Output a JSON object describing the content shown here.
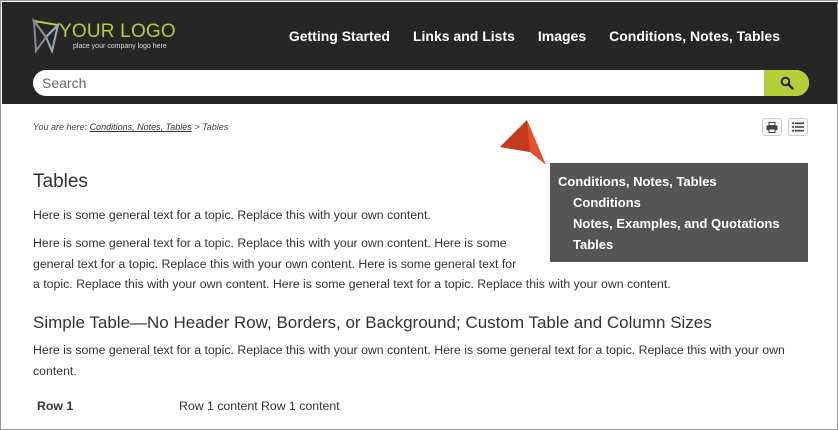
{
  "logo": {
    "title": "YOUR LOGO",
    "subtitle": "place your company logo here"
  },
  "nav": {
    "items": [
      {
        "label": "Getting Started"
      },
      {
        "label": "Links and Lists"
      },
      {
        "label": "Images"
      },
      {
        "label": "Conditions, Notes, Tables"
      }
    ]
  },
  "search": {
    "placeholder": "Search"
  },
  "breadcrumb": {
    "prefix": "You are here:",
    "link": "Conditions, Notes, Tables",
    "separator": ">",
    "current": "Tables"
  },
  "mini_toc": {
    "parent": "Conditions, Notes, Tables",
    "items": [
      {
        "label": "Conditions"
      },
      {
        "label": "Notes, Examples, and Quotations"
      },
      {
        "label": "Tables"
      }
    ]
  },
  "content": {
    "title": "Tables",
    "para1": "Here is some general text for a topic. Replace this with your own content.",
    "para2a": "Here is some general text for a topic. Replace this with your own content. Here is some general text for a topic. Replace this with your own content. Here is some general text for",
    "para2b": "a topic. Replace this with your own content. Here is some general text for a topic. Replace this with your own content.",
    "subheading": "Simple Table—No Header Row, Borders, or Background; Custom Table and Column Sizes",
    "para3": "Here is some general text for a topic. Replace this with your own content. Here is some general text for a topic. Replace this with your own content.",
    "table": {
      "row_head": "Row 1",
      "row_cell": "Row 1 content Row 1 content"
    }
  },
  "colors": {
    "header": "#262626",
    "accent": "#b5cf3a",
    "toc_bg": "#555555",
    "pointer": "#e8502a"
  },
  "icons": {
    "search": "search-icon",
    "print": "print-icon",
    "toc": "list-icon",
    "pointer": "pointer-arrow-icon"
  }
}
